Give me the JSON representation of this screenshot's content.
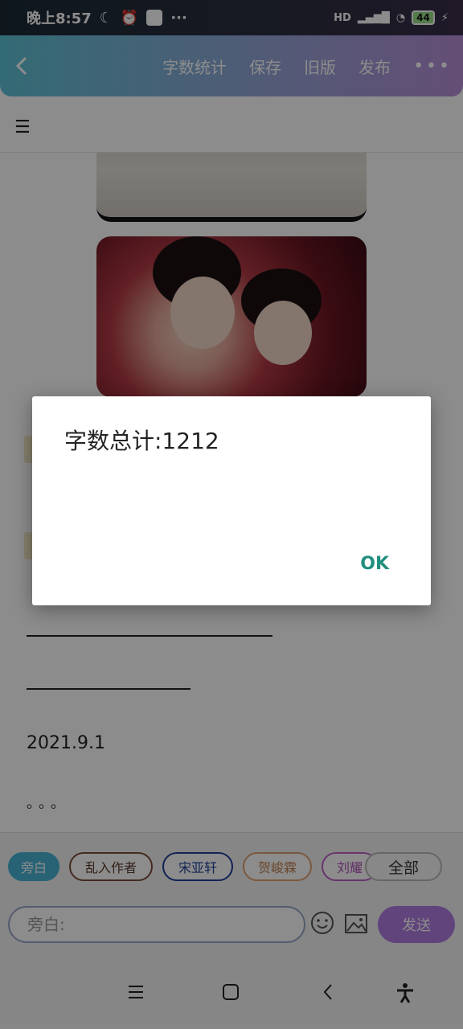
{
  "status_bar": {
    "time": "晚上8:57",
    "more": "···",
    "battery": "44",
    "network": "HD"
  },
  "toolbar": {
    "back_icon": "chevron-left-icon",
    "word_count": "字数统计",
    "save": "保存",
    "old_version": "旧版",
    "publish": "发布",
    "more": "•••"
  },
  "menu": {
    "hamburger": "☰"
  },
  "content": {
    "date": "2021.9.1",
    "ellipsis": "。。。"
  },
  "chips": [
    {
      "label": "旁白",
      "color": "#49b4d6"
    },
    {
      "label": "乱入作者",
      "color": "#7a4b3a"
    },
    {
      "label": "宋亚轩",
      "color": "#1f3f9a"
    },
    {
      "label": "贺峻霖",
      "color": "#e0a070"
    },
    {
      "label": "刘耀",
      "color": "#c060c8"
    }
  ],
  "chips_all": "全部",
  "composer": {
    "placeholder": "旁白:",
    "send": "发送"
  },
  "dialog": {
    "title": "字数总计:1212",
    "ok": "OK"
  },
  "colors": {
    "toolbar_start": "#5ec3d6",
    "toolbar_end": "#b78fd7",
    "accent_ok": "#1f8f7f",
    "send": "#b07ce0"
  }
}
